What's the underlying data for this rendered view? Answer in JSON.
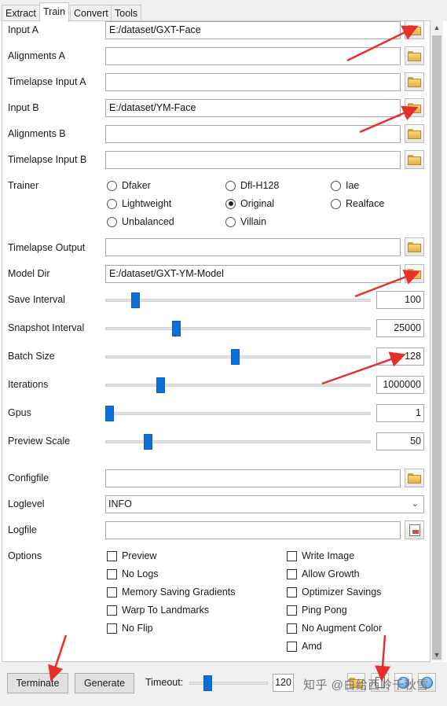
{
  "tabs": [
    {
      "label": "Extract",
      "active": false
    },
    {
      "label": "Train",
      "active": true
    },
    {
      "label": "Convert",
      "active": false
    },
    {
      "label": "Tools",
      "active": false
    }
  ],
  "fields": {
    "input_a": {
      "label": "Input A",
      "value": "E:/dataset/GXT-Face"
    },
    "alignments_a": {
      "label": "Alignments A",
      "value": ""
    },
    "timelapse_input_a": {
      "label": "Timelapse Input A",
      "value": ""
    },
    "input_b": {
      "label": "Input B",
      "value": "E:/dataset/YM-Face"
    },
    "alignments_b": {
      "label": "Alignments B",
      "value": ""
    },
    "timelapse_input_b": {
      "label": "Timelapse Input B",
      "value": ""
    },
    "timelapse_output": {
      "label": "Timelapse Output",
      "value": ""
    },
    "model_dir": {
      "label": "Model Dir",
      "value": "E:/dataset/GXT-YM-Model"
    },
    "configfile": {
      "label": "Configfile",
      "value": ""
    },
    "logfile": {
      "label": "Logfile",
      "value": ""
    }
  },
  "trainer": {
    "label": "Trainer",
    "options": [
      "Dfaker",
      "Dfl-H128",
      "Iae",
      "Lightweight",
      "Original",
      "Realface",
      "Unbalanced",
      "Villain"
    ],
    "selected": "Original"
  },
  "sliders": {
    "save_interval": {
      "label": "Save Interval",
      "value": "100",
      "fraction": 0.1
    },
    "snapshot_interval": {
      "label": "Snapshot Interval",
      "value": "25000",
      "fraction": 0.26
    },
    "batch_size": {
      "label": "Batch Size",
      "value": "128",
      "fraction": 0.49
    },
    "iterations": {
      "label": "Iterations",
      "value": "1000000",
      "fraction": 0.2
    },
    "gpus": {
      "label": "Gpus",
      "value": "1",
      "fraction": 0.0
    },
    "preview_scale": {
      "label": "Preview Scale",
      "value": "50",
      "fraction": 0.15
    }
  },
  "loglevel": {
    "label": "Loglevel",
    "value": "INFO"
  },
  "options": {
    "label": "Options",
    "items": [
      {
        "label": "Preview",
        "checked": false
      },
      {
        "label": "Write Image",
        "checked": false
      },
      {
        "label": "No Logs",
        "checked": false
      },
      {
        "label": "Allow Growth",
        "checked": false
      },
      {
        "label": "Memory Saving Gradients",
        "checked": false
      },
      {
        "label": "Optimizer Savings",
        "checked": false
      },
      {
        "label": "Warp To Landmarks",
        "checked": false
      },
      {
        "label": "Ping Pong",
        "checked": false
      },
      {
        "label": "No Flip",
        "checked": false
      },
      {
        "label": "No Augment Color",
        "checked": false
      },
      {
        "label": "Amd",
        "checked": false
      }
    ]
  },
  "bottom": {
    "terminate_label": "Terminate",
    "generate_label": "Generate",
    "timeout_label": "Timeout:",
    "timeout_value": "120",
    "timeout_fraction": 0.09
  },
  "watermark": "知乎 @白给西岭千秋雪",
  "colors": {
    "accent": "#0a6fd6",
    "annotation": "#e8302a"
  }
}
